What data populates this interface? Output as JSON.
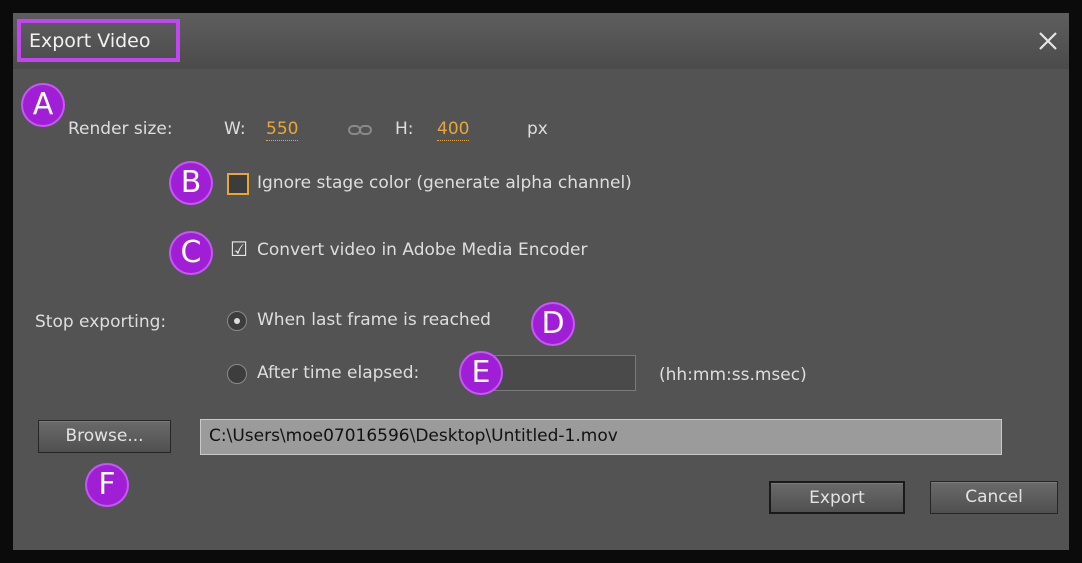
{
  "dialog": {
    "title": "Export Video",
    "close_icon": "close-icon"
  },
  "render_size": {
    "label": "Render size:",
    "width_label": "W:",
    "width_value": "550",
    "link_icon": "link-icon",
    "height_label": "H:",
    "height_value": "400",
    "unit": "px"
  },
  "options": {
    "ignore_stage_color": {
      "label": "Ignore stage color (generate alpha channel)",
      "checked": false
    },
    "convert_video": {
      "label": "Convert video in Adobe Media Encoder",
      "checked": true,
      "checkmark": "☑"
    }
  },
  "stop_exporting": {
    "label": "Stop exporting:",
    "last_frame": {
      "label": "When last frame is reached",
      "selected": true
    },
    "after_time": {
      "label": "After time elapsed:",
      "selected": false,
      "value": ""
    },
    "time_format": "(hh:mm:ss.msec)"
  },
  "file": {
    "browse_label": "Browse...",
    "path": "C:\\Users\\moe07016596\\Desktop\\Untitled-1.mov"
  },
  "buttons": {
    "export_label": "Export",
    "cancel_label": "Cancel"
  },
  "annotations": {
    "a": "A",
    "b": "B",
    "c": "C",
    "d": "D",
    "e": "E",
    "f": "F",
    "color": "#a01ed6"
  },
  "colors": {
    "accent": "#e8a63a",
    "highlight_border": "#c046f0",
    "panel": "#535353"
  }
}
